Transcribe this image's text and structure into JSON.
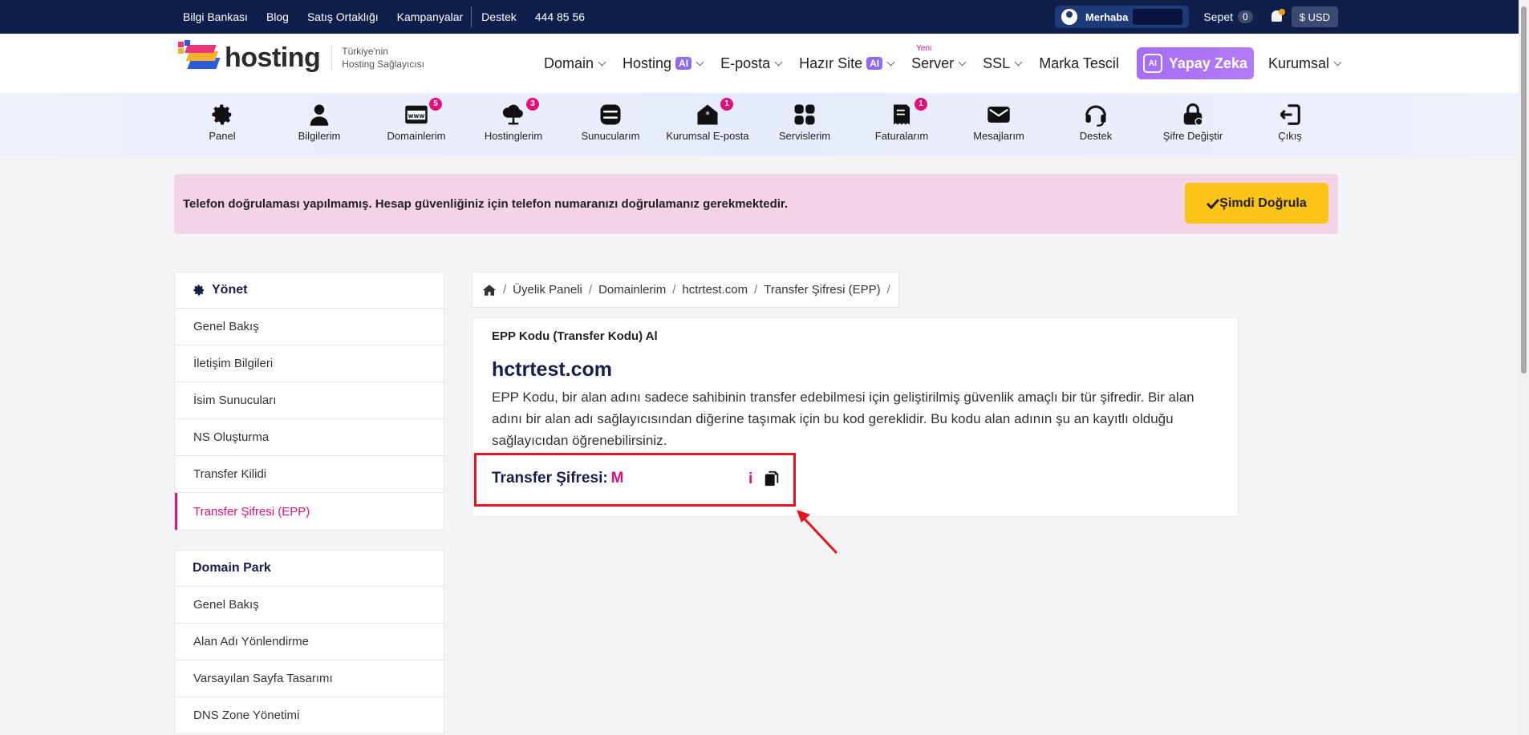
{
  "topbar": {
    "links": [
      "Bilgi Bankası",
      "Blog",
      "Satış Ortaklığı",
      "Kampanyalar"
    ],
    "support": "Destek",
    "phone": "444 85 56",
    "greeting": "Merhaba",
    "cart_label": "Sepet",
    "cart_count": "0",
    "currency": "$ USD"
  },
  "logo": {
    "text": "hosting",
    "tagline_1": "Türkiye'nin",
    "tagline_2": "Hosting Sağlayıcısı"
  },
  "mainnav": {
    "domain": "Domain",
    "hosting": "Hosting",
    "eposta": "E-posta",
    "hazir_site": "Hazır Site",
    "server": "Server",
    "server_badge": "Yeni",
    "ssl": "SSL",
    "marka": "Marka Tescil",
    "yapay_zeka": "Yapay Zeka",
    "kurumsal": "Kurumsal",
    "ai_badge": "AI"
  },
  "iconnav": [
    {
      "label": "Panel",
      "icon": "gear-icon",
      "badge": ""
    },
    {
      "label": "Bilgilerim",
      "icon": "user-icon",
      "badge": ""
    },
    {
      "label": "Domainlerim",
      "icon": "www-icon",
      "badge": "5"
    },
    {
      "label": "Hostinglerim",
      "icon": "cloud-icon",
      "badge": "3"
    },
    {
      "label": "Sunucularım",
      "icon": "server-icon",
      "badge": ""
    },
    {
      "label": "Kurumsal E-posta",
      "icon": "mail-open-icon",
      "badge": "1"
    },
    {
      "label": "Servislerim",
      "icon": "grid-icon",
      "badge": ""
    },
    {
      "label": "Faturalarım",
      "icon": "invoice-icon",
      "badge": "1"
    },
    {
      "label": "Mesajlarım",
      "icon": "envelope-icon",
      "badge": ""
    },
    {
      "label": "Destek",
      "icon": "headset-icon",
      "badge": ""
    },
    {
      "label": "Şifre Değiştir",
      "icon": "lock-icon",
      "badge": ""
    },
    {
      "label": "Çıkış",
      "icon": "logout-icon",
      "badge": ""
    }
  ],
  "alert": {
    "message": "Telefon doğrulaması yapılmamış. Hesap güvenliğiniz için telefon numaranızı doğrulamanız gerekmektedir.",
    "button": "Şimdi Doğrula"
  },
  "sidebar": {
    "manage_title": "Yönet",
    "manage_items": [
      "Genel Bakış",
      "İletişim Bilgileri",
      "İsim Sunucuları",
      "NS Oluşturma",
      "Transfer Kilidi",
      "Transfer Şifresi (EPP)"
    ],
    "park_title": "Domain Park",
    "park_items": [
      "Genel Bakış",
      "Alan Adı Yönlendirme",
      "Varsayılan Sayfa Tasarımı",
      "DNS Zone Yönetimi"
    ]
  },
  "breadcrumb": [
    "Üyelik Paneli",
    "Domainlerim",
    "hctrtest.com",
    "Transfer Şifresi (EPP)"
  ],
  "card": {
    "title": "EPP Kodu (Transfer Kodu) Al",
    "domain": "hctrtest.com",
    "description": "EPP Kodu, bir alan adını sadece sahibinin transfer edebilmesi için geliştirilmiş güvenlik amaçlı bir tür şifredir. Bir alan adını bir alan adı sağlayıcısından diğerine taşımak için bu kod gereklidir. Bu kodu alan adının şu an kayıtlı olduğu sağlayıcıdan öğrenebilirsiniz.",
    "password_label": "Transfer Şifresi:",
    "password_value": "M",
    "info_glyph": "i"
  },
  "colors": {
    "accent": "#e0117b",
    "navy": "#0d1f4a",
    "alert_bg": "#f5d3e6",
    "button": "#fcc419",
    "highlight": "#e8131f"
  }
}
